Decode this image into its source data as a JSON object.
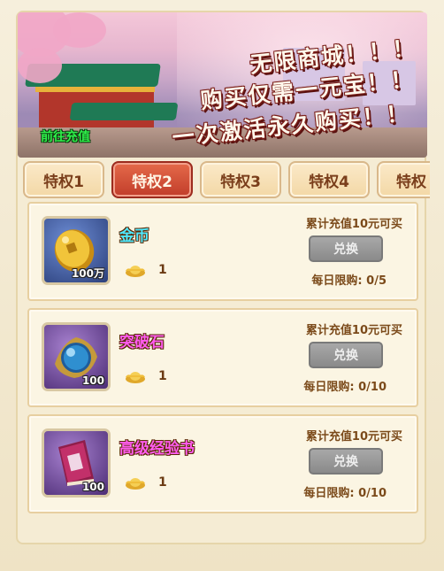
{
  "banner": {
    "line1": "无限商城！！！",
    "line2": "购买仅需一元宝！！",
    "line3": "一次激活永久购买！！",
    "recharge_link": "前往充值"
  },
  "tabs": [
    {
      "label": "特权1",
      "active": false
    },
    {
      "label": "特权2",
      "active": true
    },
    {
      "label": "特权3",
      "active": false
    },
    {
      "label": "特权4",
      "active": false
    },
    {
      "label": "特权",
      "active": false
    }
  ],
  "items": [
    {
      "name": "金币",
      "icon": "gold-coin-icon",
      "quantity": "100万",
      "price": "1",
      "requirement": "累计充值10元可买",
      "button_label": "兑换",
      "limit": "每日限购: 0/5"
    },
    {
      "name": "突破石",
      "icon": "breakthrough-stone-icon",
      "quantity": "100",
      "price": "1",
      "requirement": "累计充值10元可买",
      "button_label": "兑换",
      "limit": "每日限购: 0/10"
    },
    {
      "name": "高级经验书",
      "icon": "exp-book-icon",
      "quantity": "100",
      "price": "1",
      "requirement": "累计充值10元可买",
      "button_label": "兑换",
      "limit": "每日限购: 0/10"
    }
  ],
  "colors": {
    "active_tab": "#c9442f",
    "tab": "#f6ddb0",
    "disabled_button": "#999999",
    "name_gold": "#4fe9ff",
    "name_purple": "#ff5cf0"
  }
}
